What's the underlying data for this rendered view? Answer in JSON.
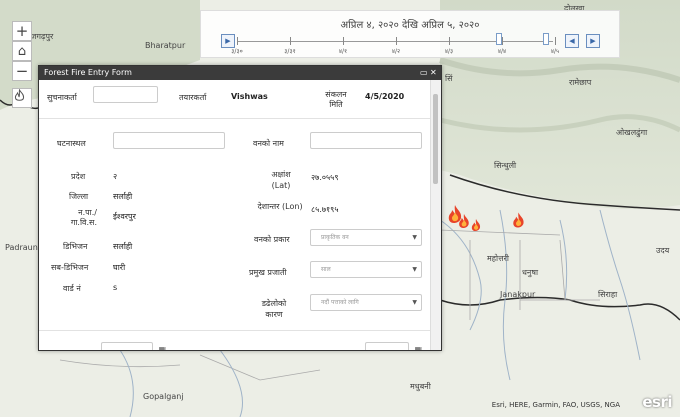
{
  "map": {
    "places": [
      {
        "id": "bharatpur",
        "text": "Bharatpur"
      },
      {
        "id": "nijgadh",
        "text": "निजगढ़पुर"
      },
      {
        "id": "padauna",
        "text": "Padrauna"
      },
      {
        "id": "gopalganj",
        "text": "Gopalganj"
      },
      {
        "id": "mahottari",
        "text": "महोत्तरी"
      },
      {
        "id": "dhanusha",
        "text": "धनुषा"
      },
      {
        "id": "janakpur",
        "text": "Janakpur"
      },
      {
        "id": "siraha",
        "text": "सिराहा"
      },
      {
        "id": "sindhuli",
        "text": "सिन्धुली"
      },
      {
        "id": "okhaldhunga",
        "text": "ओखलढुंगा"
      },
      {
        "id": "ramechhap",
        "text": "रामेछाप"
      },
      {
        "id": "dolakha",
        "text": "दोलखा"
      },
      {
        "id": "udayapur",
        "text": "उदय"
      },
      {
        "id": "madhubani",
        "text": "मधुबनी"
      },
      {
        "id": "unknown_top",
        "text": "सिं"
      }
    ],
    "attribution": "Esri, HERE, Garmin, FAO, USGS, NGA",
    "logo": "esri",
    "controls": {
      "zoom_in": "+",
      "home": "⌂",
      "zoom_out": "−",
      "fire_icon": "fire-icon"
    }
  },
  "time_slider": {
    "title": "अप्रिल ४, २०२० देखि अप्रिल ५, २०२०",
    "ticks": [
      "३/३०",
      "३/३१",
      "४/१",
      "४/२",
      "४/३",
      "४/४",
      "४/५"
    ],
    "range_fraction": [
      0.8,
      1.0
    ]
  },
  "form": {
    "title": "Forest Fire Entry Form",
    "fields": {
      "reporter_label": "सुचनाकर्ता",
      "reporter_value": "",
      "recorder_label": "तयारकर्ता",
      "recorder_value": "Vishwas",
      "date_label": "संकलन मिति",
      "date_value": "4/5/2020",
      "location_label": "घटनास्थल",
      "forest_name_label": "वनको नाम",
      "province_label": "प्रदेश",
      "province_value": "२",
      "district_label": "जिल्ला",
      "district_value": "सर्लाही",
      "municipality_label": "न.पा./ गा.वि.स.",
      "municipality_value": "ईश्वरपुर",
      "division_label": "डिभिजन",
      "division_value": "सर्लाही",
      "subdivision_label": "सब-डिभिजन",
      "subdivision_value": "घारी",
      "ward_label": "वार्ड नं",
      "ward_value": "s",
      "lat_label": "अक्षांश (Lat)",
      "lat_value": "२७.०५५९",
      "lon_label": "देशान्तर (Lon)",
      "lon_value": "८५.७१९५",
      "forest_type_label": "वनको प्रकार",
      "forest_type_value": "प्राकृतिक वन",
      "species_label": "प्रमुख प्रजाती",
      "species_value": "साल",
      "cause_label": "डढेलोको कारण",
      "cause_value": "नदौं पत्ताको लागि"
    }
  }
}
